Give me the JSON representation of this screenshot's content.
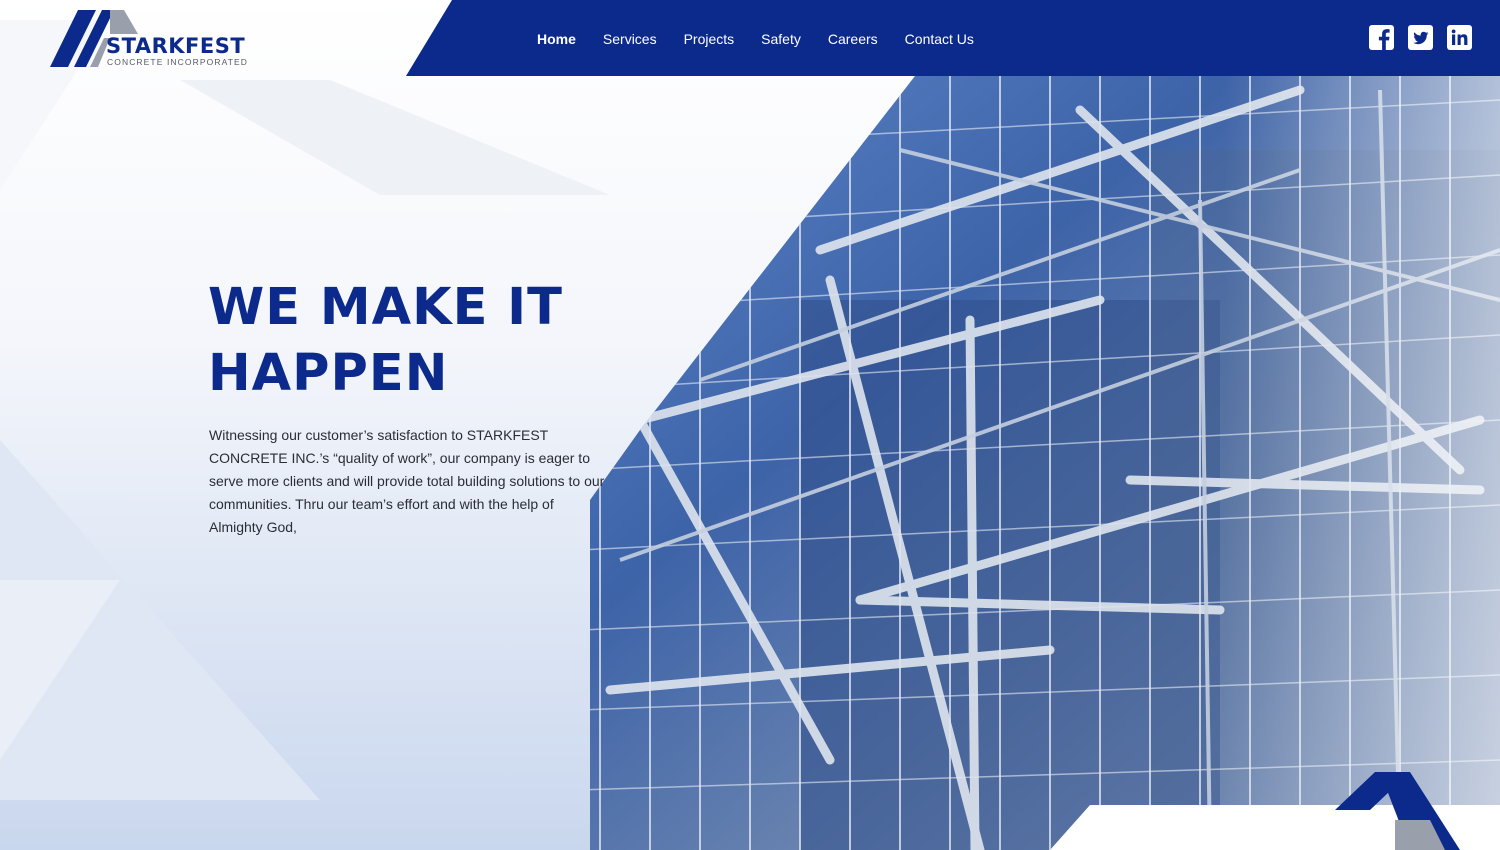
{
  "brand": {
    "name": "STARKFEST",
    "tagline": "CONCRETE INCORPORATED"
  },
  "nav": {
    "items": [
      {
        "label": "Home",
        "active": true
      },
      {
        "label": "Services",
        "active": false
      },
      {
        "label": "Projects",
        "active": false
      },
      {
        "label": "Safety",
        "active": false
      },
      {
        "label": "Careers",
        "active": false
      },
      {
        "label": "Contact Us",
        "active": false
      }
    ]
  },
  "social": [
    {
      "icon": "facebook-icon"
    },
    {
      "icon": "twitter-icon"
    },
    {
      "icon": "linkedin-icon"
    }
  ],
  "hero": {
    "title_line1": "WE MAKE IT",
    "title_line2": "HAPPEN",
    "text": "Witnessing our customer’s satisfaction to STARKFEST CONCRETE INC.’s “quality of work”, our company is eager to serve more clients and will provide total building solutions to our communities. Thru our team’s effort and with the help of Almighty God,"
  },
  "colors": {
    "brand_blue": "#0b2a8c",
    "logo_gray": "#9aa0ab",
    "text": "#2a2d35"
  }
}
